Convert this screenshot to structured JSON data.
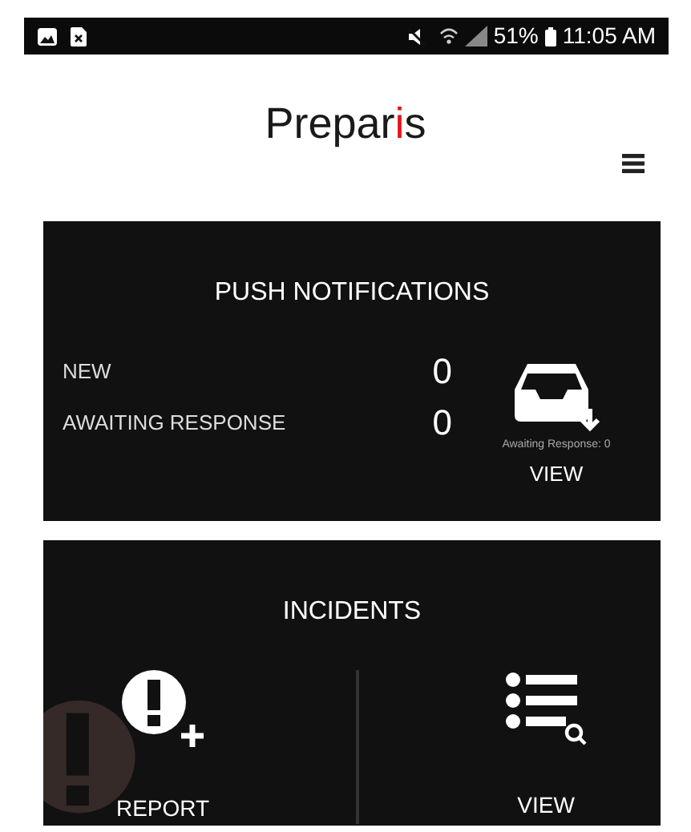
{
  "status_bar": {
    "battery": "51%",
    "time": "11:05 AM"
  },
  "logo": {
    "parts": [
      {
        "text": "Prepar",
        "accent": false
      },
      {
        "text": "i",
        "accent": true
      },
      {
        "text": "s",
        "accent": false
      }
    ]
  },
  "push_notifications": {
    "title": "PUSH NOTIFICATIONS",
    "rows": [
      {
        "label": "NEW",
        "count": "0"
      },
      {
        "label": "AWAITING RESPONSE",
        "count": "0"
      }
    ],
    "view": {
      "caption": "Awaiting Response: 0",
      "label": "VIEW"
    }
  },
  "incidents": {
    "title": "INCIDENTS",
    "actions": [
      {
        "kind": "report",
        "label": "REPORT"
      },
      {
        "kind": "view",
        "label": "VIEW"
      }
    ]
  }
}
